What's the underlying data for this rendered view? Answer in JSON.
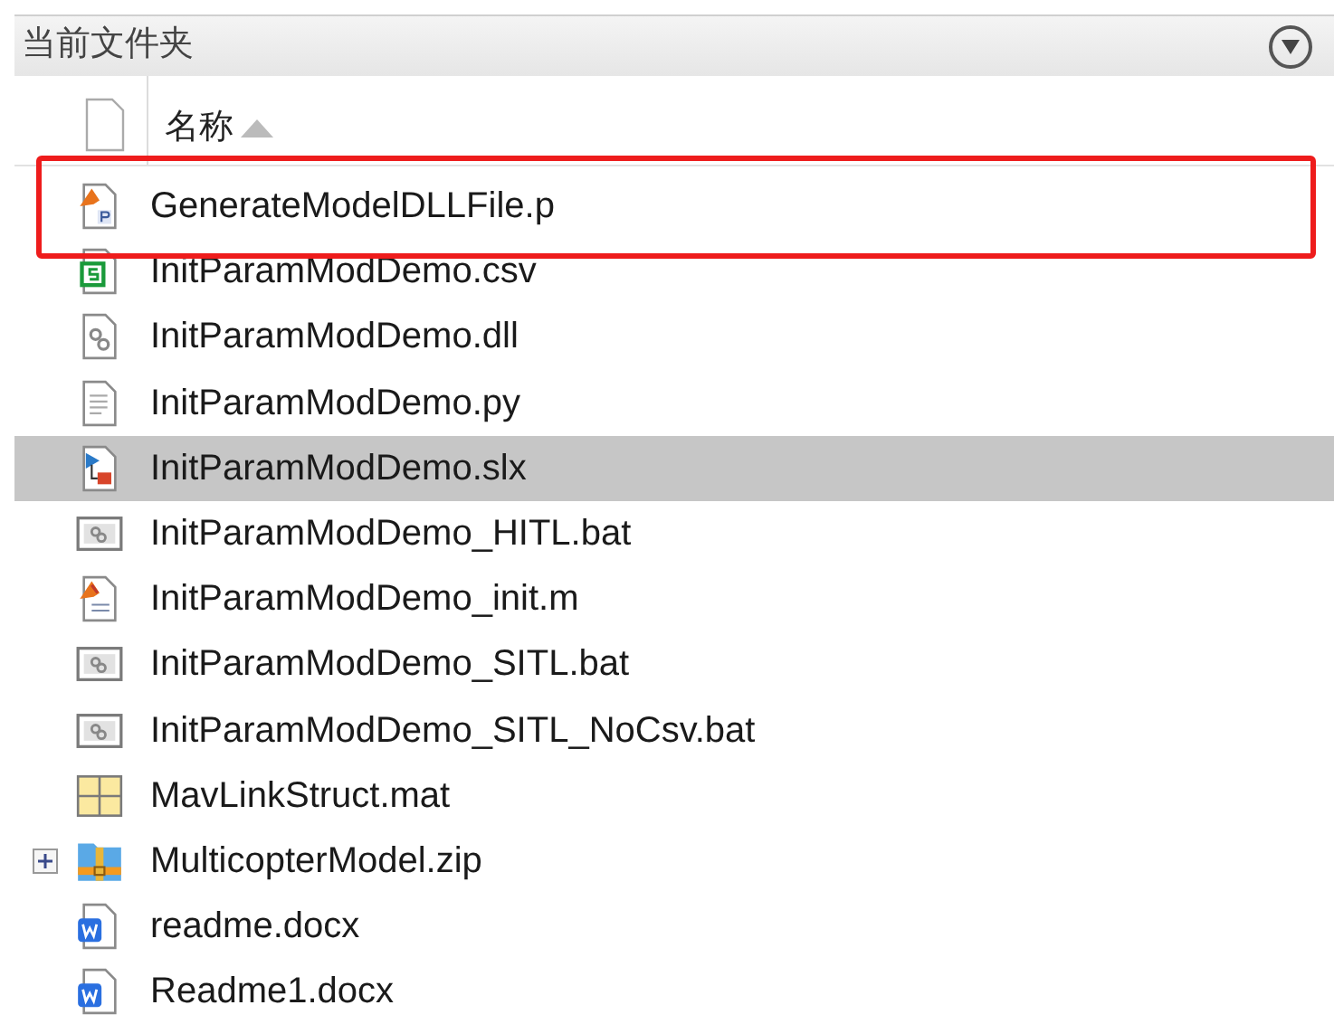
{
  "panel": {
    "title": "当前文件夹"
  },
  "columns": [
    {
      "label": "名称",
      "sorted_ascending": true
    }
  ],
  "files": [
    {
      "name": "GenerateModelDLLFile.p",
      "kind": "pcode",
      "selected": false,
      "highlighted": true,
      "expandable": false
    },
    {
      "name": "InitParamModDemo.csv",
      "kind": "csv",
      "selected": false,
      "highlighted": false,
      "expandable": false
    },
    {
      "name": "InitParamModDemo.dll",
      "kind": "dll",
      "selected": false,
      "highlighted": false,
      "expandable": false
    },
    {
      "name": "InitParamModDemo.py",
      "kind": "text",
      "selected": false,
      "highlighted": false,
      "expandable": false
    },
    {
      "name": "InitParamModDemo.slx",
      "kind": "model",
      "selected": true,
      "highlighted": false,
      "expandable": false
    },
    {
      "name": "InitParamModDemo_HITL.bat",
      "kind": "batch",
      "selected": false,
      "highlighted": false,
      "expandable": false
    },
    {
      "name": "InitParamModDemo_init.m",
      "kind": "script",
      "selected": false,
      "highlighted": false,
      "expandable": false
    },
    {
      "name": "InitParamModDemo_SITL.bat",
      "kind": "batch",
      "selected": false,
      "highlighted": false,
      "expandable": false
    },
    {
      "name": "InitParamModDemo_SITL_NoCsv.bat",
      "kind": "batch",
      "selected": false,
      "highlighted": false,
      "expandable": false
    },
    {
      "name": "MavLinkStruct.mat",
      "kind": "mat",
      "selected": false,
      "highlighted": false,
      "expandable": false
    },
    {
      "name": "MulticopterModel.zip",
      "kind": "zip",
      "selected": false,
      "highlighted": false,
      "expandable": true
    },
    {
      "name": "readme.docx",
      "kind": "word",
      "selected": false,
      "highlighted": false,
      "expandable": false
    },
    {
      "name": "Readme1.docx",
      "kind": "word",
      "selected": false,
      "highlighted": false,
      "expandable": false
    }
  ]
}
